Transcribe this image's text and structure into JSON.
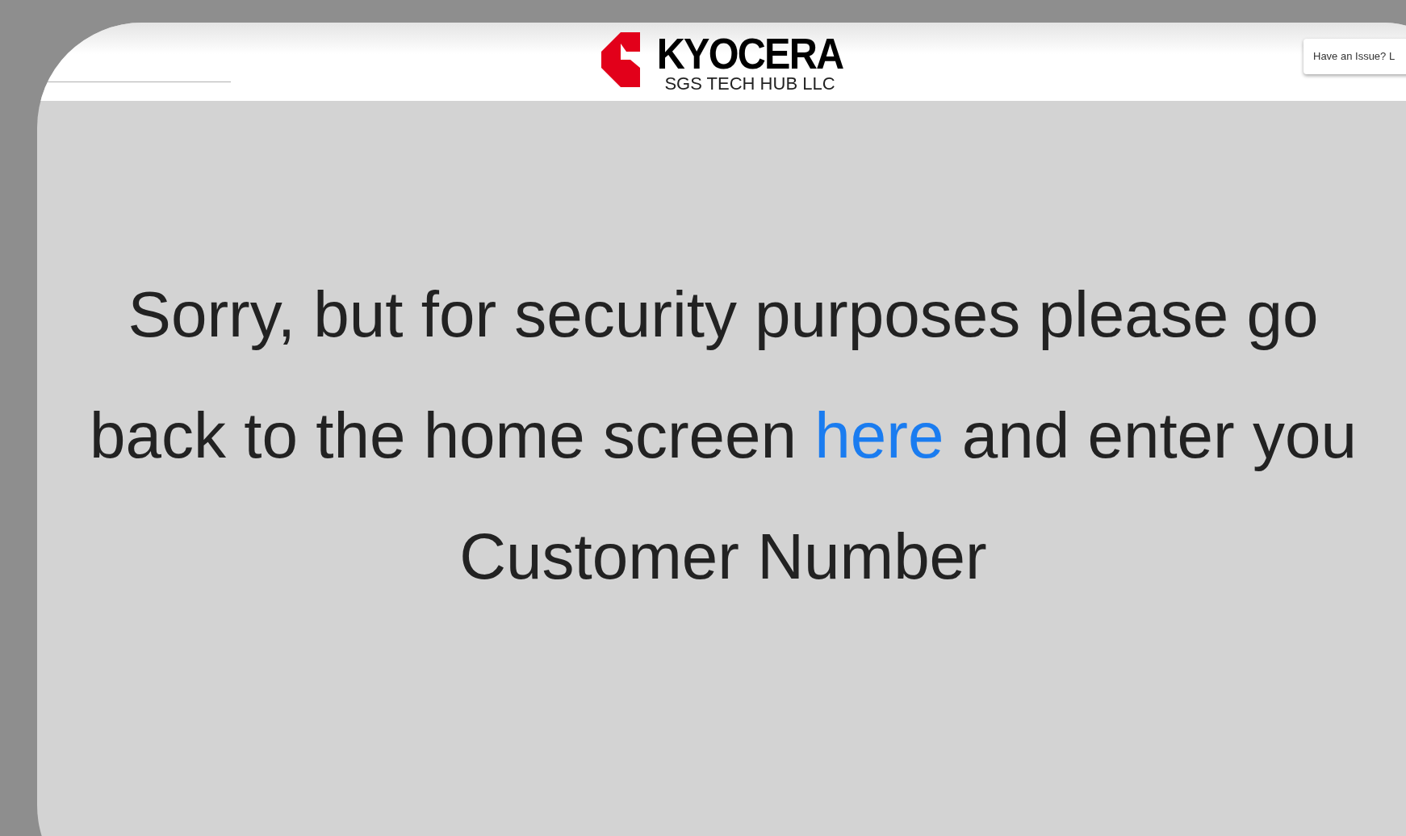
{
  "header": {
    "logo": {
      "name": "KYOCERA",
      "subtitle": "SGS TECH HUB LLC"
    },
    "issue_button": {
      "label": "Have an Issue? L"
    }
  },
  "message": {
    "line_1": "Sorry, but for security purposes please go",
    "line_2_before": "back to the home screen",
    "link": "here",
    "line_2_after": "and enter you",
    "line_3": "Customer Number"
  }
}
